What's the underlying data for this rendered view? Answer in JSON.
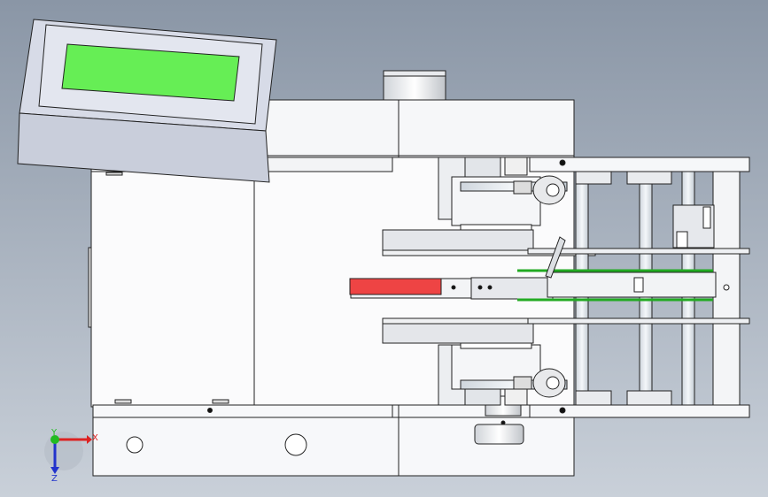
{
  "viewport": {
    "background_top": "#8a96a6",
    "background_bottom": "#c9d0d9"
  },
  "lcd": {
    "screen_color": "#66ee55",
    "bezel_color": "#d7dbe7"
  },
  "highlights": {
    "red_part": "#ee4444",
    "green_rail": "#22aa22"
  },
  "triad": {
    "x_label": "X",
    "y_label": "Y",
    "z_label": "Z",
    "x_color": "#dd2222",
    "y_color": "#22bb22",
    "z_color": "#2233cc"
  }
}
